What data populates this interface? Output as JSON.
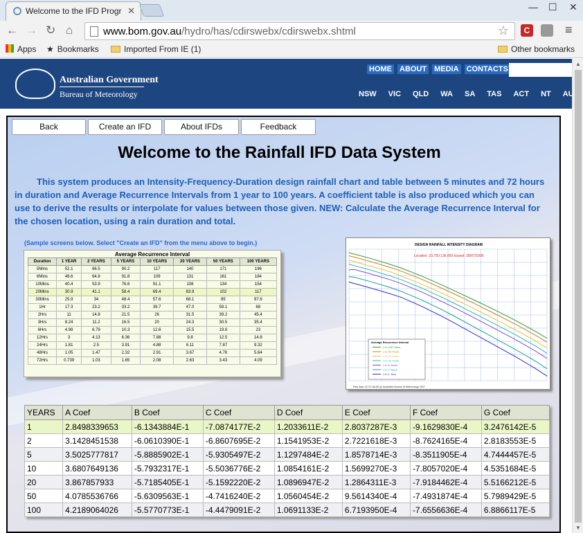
{
  "browser": {
    "tab_title": "Welcome to the IFD Progr",
    "url_host": "www.bom.gov.au",
    "url_path": "/hydro/has/cdirswebx/cdirswebx.shtml",
    "bookmarks": [
      "Apps",
      "Bookmarks",
      "Imported From IE (1)"
    ],
    "other_bookmarks": "Other bookmarks",
    "ext_badge": "C"
  },
  "bom": {
    "gov_line1": "Australian Government",
    "gov_line2": "Bureau of Meteorology",
    "top_links": [
      "HOME",
      "ABOUT",
      "MEDIA",
      "CONTACTS"
    ],
    "states": [
      "NSW",
      "VIC",
      "QLD",
      "WA",
      "SA",
      "TAS",
      "ACT",
      "NT",
      "AUSTRA"
    ]
  },
  "ifd": {
    "menu": [
      "Back",
      "Create an IFD",
      "About IFDs",
      "Feedback"
    ],
    "title": "Welcome to the Rainfall IFD Data System",
    "intro": "This system produces an Intensity-Frequency-Duration design rainfall chart and table between 5 minutes and 72 hours in duration and Average Recurrence Intervals  from 1 year to 100 years.  A coefficient table is also produced which you can use to derive the results or interpolate for values between those given. NEW: Calculate the Average Recurrence Interval for the chosen location, using a rain duration and total.",
    "caption": "(Sample screens below. Select  \"Create an IFD\" from the menu above to begin.)",
    "sample_table": {
      "title": "Average Recurrence Interval",
      "headers": [
        "Duration",
        "1 YEAR",
        "2 YEARS",
        "5 YEARS",
        "10 YEARS",
        "20 YEARS",
        "50 YEARS",
        "100 YEARS"
      ],
      "rows": [
        [
          "5Mins",
          "52.1",
          "66.5",
          "90.2",
          "117",
          "140",
          "171",
          "196"
        ],
        [
          "6Mins",
          "48.6",
          "64.8",
          "91.8",
          "109",
          "131",
          "161",
          "184"
        ],
        [
          "10Mins",
          "40.4",
          "53.9",
          "76.6",
          "91.1",
          "108",
          "134",
          "154"
        ],
        [
          "20Mins",
          "30.9",
          "41.1",
          "58.4",
          "69.4",
          "83.9",
          "102",
          "117"
        ],
        [
          "30Mins",
          "25.9",
          "34",
          "48.4",
          "57.6",
          "68.1",
          "85",
          "97.6"
        ],
        [
          "1Hr",
          "17.3",
          "23.2",
          "33.2",
          "39.7",
          "47.0",
          "59.1",
          "68"
        ],
        [
          "2Hrs",
          "11",
          "14.8",
          "21.5",
          "26",
          "31.5",
          "39.2",
          "45.4"
        ],
        [
          "3Hrs",
          "8.24",
          "11.2",
          "16.5",
          "20",
          "24.3",
          "30.5",
          "35.4"
        ],
        [
          "6Hrs",
          "4.98",
          "6.79",
          "10.3",
          "12.6",
          "15.5",
          "19.8",
          "23"
        ],
        [
          "12Hrs",
          "3",
          "4.13",
          "6.36",
          "7.88",
          "9.8",
          "12.5",
          "14.8"
        ],
        [
          "24Hrs",
          "1.81",
          "2.5",
          "3.91",
          "4.88",
          "6.11",
          "7.87",
          "9.32"
        ],
        [
          "48Hrs",
          "1.05",
          "1.47",
          "2.32",
          "2.91",
          "3.67",
          "4.76",
          "5.64"
        ],
        [
          "72Hrs",
          "0.739",
          "1.03",
          "1.65",
          "2.08",
          "2.63",
          "3.43",
          "4.09"
        ]
      ]
    },
    "sample_chart": {
      "title": "DESIGN RAINFALL INTENSITY DIAGRAM",
      "subtitle": "Location: 23.750  136.850   Issued: 28/07/2008",
      "legend_title": "Average Recurrence Interval",
      "legend_entries": [
        "1 in 100 Years",
        "1 in 50 Years",
        "1 in 20 Years",
        "1 in 10 Years",
        "1 in 5 Years",
        "1 in 2 Years",
        "1 in 1 Year"
      ],
      "series_colors": [
        "#2a9d2a",
        "#d07a1e",
        "#e8c32a",
        "#29b3c9",
        "#7c4ec4",
        "#1f9b9b",
        "#2a2ae0"
      ],
      "footer": "Raw data: 23.75  136.85   (c) Australian Bureau of Meteorology 2007"
    },
    "coef_table": {
      "headers": [
        "YEARS",
        "A Coef",
        "B Coef",
        "C Coef",
        "D Coef",
        "E Coef",
        "F Coef",
        "G Coef"
      ],
      "rows": [
        [
          "1",
          "2.8498339653",
          "-6.1343884E-1",
          "-7.0874177E-2",
          "1.2033611E-2",
          "2.8037287E-3",
          "-9.1629830E-4",
          "3.2476142E-5"
        ],
        [
          "2",
          "3.1428451538",
          "-6.0610390E-1",
          "-6.8607695E-2",
          "1.1541953E-2",
          "2.7221618E-3",
          "-8.7624165E-4",
          "2.8183553E-5"
        ],
        [
          "5",
          "3.5025777817",
          "-5.8885902E-1",
          "-5.9305497E-2",
          "1.1297484E-2",
          "1.8578714E-3",
          "-8.3511905E-4",
          "4.7444457E-5"
        ],
        [
          "10",
          "3.6807649136",
          "-5.7932317E-1",
          "-5.5036776E-2",
          "1.0854161E-2",
          "1.5699270E-3",
          "-7.8057020E-4",
          "4.5351684E-5"
        ],
        [
          "20",
          "3.867857933",
          "-5.7185405E-1",
          "-5.1592220E-2",
          "1.0896947E-2",
          "1.2864311E-3",
          "-7.9184462E-4",
          "5.5166212E-5"
        ],
        [
          "50",
          "4.0785536766",
          "-5.6309563E-1",
          "-4.7416240E-2",
          "1.0560454E-2",
          "9.5614340E-4",
          "-7.4931874E-4",
          "5.7989429E-5"
        ],
        [
          "100",
          "4.2189064026",
          "-5.5770773E-1",
          "-4.4479091E-2",
          "1.0691133E-2",
          "6.7193950E-4",
          "-7.6556636E-4",
          "6.8866117E-5"
        ]
      ]
    }
  }
}
